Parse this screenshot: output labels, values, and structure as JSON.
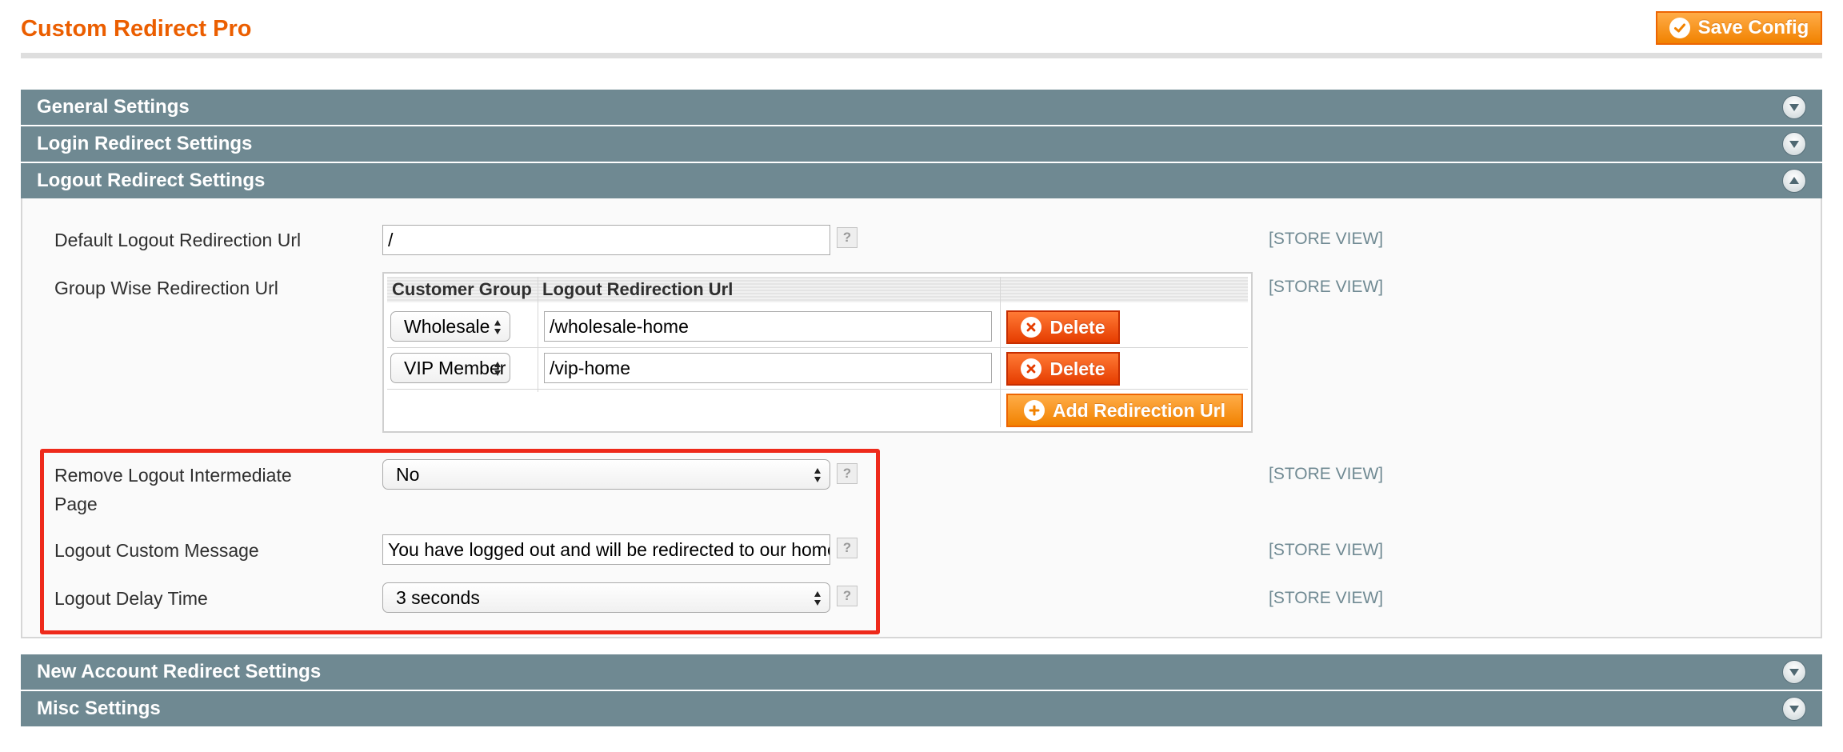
{
  "page": {
    "title": "Custom Redirect Pro",
    "save_button": "Save Config"
  },
  "sections": {
    "general": "General Settings",
    "login": "Login Redirect Settings",
    "logout": "Logout Redirect Settings",
    "new_account": "New Account Redirect Settings",
    "misc": "Misc Settings"
  },
  "logout": {
    "default_url": {
      "label": "Default Logout Redirection Url",
      "value": "/",
      "scope": "[STORE VIEW]"
    },
    "group_wise": {
      "label": "Group Wise Redirection Url",
      "scope": "[STORE VIEW]",
      "columns": [
        "Customer Group",
        "Logout Redirection Url"
      ],
      "rows": [
        {
          "group": "Wholesale",
          "url": "/wholesale-home",
          "delete": "Delete"
        },
        {
          "group": "VIP Member",
          "url": "/vip-home",
          "delete": "Delete"
        }
      ],
      "add_button": "Add Redirection Url"
    },
    "remove_intermediate": {
      "label_line1": "Remove Logout Intermediate",
      "label_line2": "Page",
      "value": "No",
      "scope": "[STORE VIEW]"
    },
    "custom_message": {
      "label": "Logout Custom Message",
      "value": "You have logged out and will be redirected to our home page",
      "scope": "[STORE VIEW]"
    },
    "delay_time": {
      "label": "Logout Delay Time",
      "value": "3 seconds",
      "scope": "[STORE VIEW]"
    },
    "help": "?"
  },
  "colors": {
    "title": "#eb5e00",
    "section_header": "#6f8992",
    "button_orange": "#f18200",
    "button_red": "#e53c00",
    "highlight": "#ee2a1b",
    "scope_text": "#6f8992"
  },
  "icons": {
    "save": "check-circle-icon",
    "expand": "chevron-down-icon",
    "collapse": "chevron-up-icon",
    "delete": "x-circle-icon",
    "add": "plus-circle-icon",
    "help": "question-icon"
  }
}
